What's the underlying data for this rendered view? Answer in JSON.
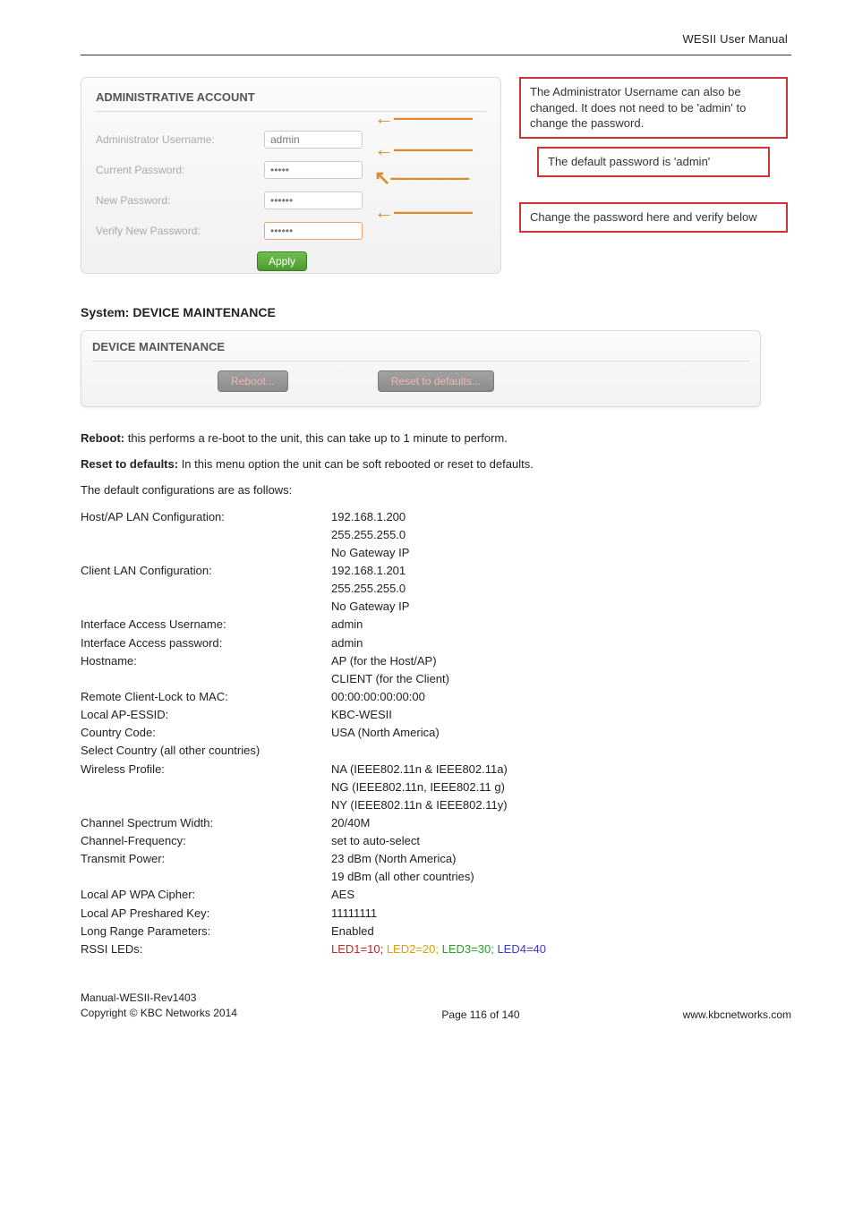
{
  "header": {
    "title": "WESII User Manual"
  },
  "admin_panel": {
    "title": "ADMINISTRATIVE ACCOUNT",
    "fields": {
      "admin_user_label": "Administrator Username:",
      "admin_user_value": "admin",
      "curr_pw_label": "Current Password:",
      "curr_pw_value": "•••••",
      "new_pw_label": "New Password:",
      "new_pw_value": "••••••",
      "verify_pw_label": "Verify New Password:",
      "verify_pw_value": "••••••"
    },
    "apply_label": "Apply",
    "annotations": {
      "a1": "The Administrator Username can also be changed. It does not need to be 'admin' to change the password.",
      "a2": "The default password is 'admin'",
      "a3": "Change the password here and verify below"
    }
  },
  "sections": {
    "sys_maint_heading": "System: DEVICE MAINTENANCE"
  },
  "maint_panel": {
    "title": "DEVICE MAINTENANCE",
    "reboot_label": "Reboot...",
    "reset_label": "Reset to defaults..."
  },
  "body_text": {
    "reboot_label": "Reboot:",
    "reboot_rest": " this performs a re-boot to the unit, this can take up to 1 minute to perform.",
    "reset_label": "Reset to defaults:",
    "reset_rest": " In this menu option the unit can be soft rebooted or reset to defaults.",
    "defaults_intro": "The default configurations are as follows:"
  },
  "defaults": {
    "host_ap_label": "Host/AP LAN Configuration:",
    "host_ap_v1": "192.168.1.200",
    "host_ap_v2": "255.255.255.0",
    "host_ap_v3": "No Gateway IP",
    "client_label": "Client LAN Configuration:",
    "client_v1": "192.168.1.201",
    "client_v2": "255.255.255.0",
    "client_v3": "No Gateway IP",
    "if_user_label": "Interface Access Username:",
    "if_user_val": "admin",
    "if_pw_label": "Interface Access password:",
    "if_pw_val": "admin",
    "hostname_label": "Hostname:",
    "hostname_v1": "AP (for the Host/AP)",
    "hostname_v2": "CLIENT (for the Client)",
    "remote_lock_label": "Remote Client-Lock to MAC:",
    "remote_lock_val": "00:00:00:00:00:00",
    "local_essid_label": "Local AP-ESSID:",
    "local_essid_val": "KBC-WESII",
    "cc_label": "Country Code:",
    "cc_val": "USA (North America)",
    "sel_country_label": "Select Country (all other countries)",
    "wprofile_label": "Wireless Profile:",
    "wprofile_v1": "NA (IEEE802.11n & IEEE802.11a)",
    "wprofile_v2": "NG (IEEE802.11n, IEEE802.11 g)",
    "wprofile_v3": "NY (IEEE802.11n & IEEE802.11y)",
    "csw_label": "Channel Spectrum Width:",
    "csw_val": "20/40M",
    "cfreq_label": "Channel-Frequency:",
    "cfreq_val": "set to auto-select",
    "txpwr_label": "Transmit Power:",
    "txpwr_v1": "23 dBm (North America)",
    "txpwr_v2": "19 dBm (all other countries)",
    "wpa_label": "Local AP WPA Cipher:",
    "wpa_val": "AES",
    "psk_label": "Local AP Preshared Key:",
    "psk_val": "11111111",
    "lrp_label": "Long Range Parameters:",
    "lrp_val": "Enabled",
    "rssi_label": "RSSI LEDs:",
    "rssi_led1": "LED1=10",
    "rssi_sep": "; ",
    "rssi_led2": "LED2=20",
    "rssi_led3": "LED3=30",
    "rssi_led4": "LED4=40"
  },
  "footer": {
    "line1": "Manual-WESII-Rev1403",
    "line2": "Copyright © KBC Networks 2014",
    "center": "Page 116 of 140",
    "right": "www.kbcnetworks.com"
  }
}
